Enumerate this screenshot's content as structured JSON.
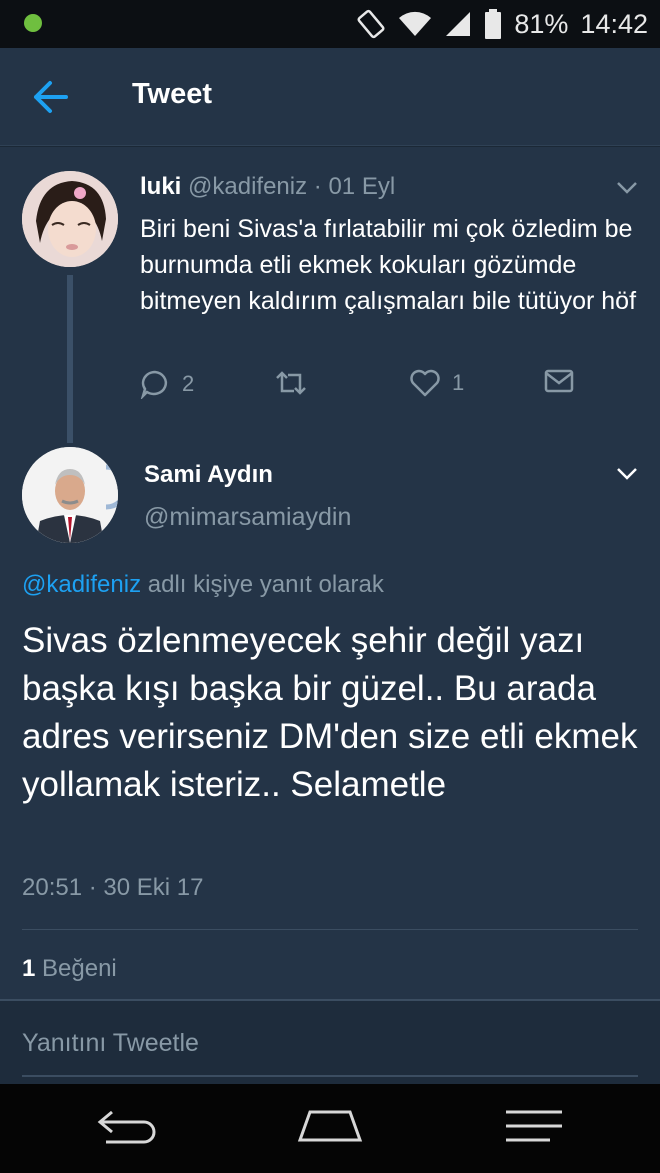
{
  "status_bar": {
    "battery": "81%",
    "time": "14:42",
    "icons": [
      "notification-dot-icon",
      "rotate-icon",
      "wifi-icon",
      "signal-icon",
      "battery-icon"
    ]
  },
  "app_bar": {
    "title": "Tweet",
    "back_icon": "back-arrow-icon"
  },
  "parent_tweet": {
    "name": "luki",
    "handle": "@kadifeniz",
    "separator": "·",
    "date": "01 Eyl",
    "text": "Biri beni Sivas'a fırlatabilir mi çok özledim be burnumda etli ekmek kokuları gözümde bitmeyen kaldırım çalışmaları bile tütüyor höf",
    "reply_count": "2",
    "like_count": "1"
  },
  "main_tweet": {
    "name": "Sami Aydın",
    "handle": "@mimarsamiaydin",
    "reply_mention": "@kadifeniz",
    "reply_suffix": " adlı kişiye yanıt olarak",
    "text": "Sivas özlenmeyecek şehir değil yazı başka kışı başka bir güzel.. Bu arada adres verirseniz DM'den size etli ekmek yollamak isteriz.. Selametle",
    "timestamp": "20:51 · 30 Eki 17",
    "like_count": "1",
    "like_label": " Beğeni"
  },
  "reply_bar": {
    "placeholder": "Yanıtını Tweetle"
  },
  "colors": {
    "background": "#243447",
    "accent": "#1da1f2",
    "secondary_text": "#8899a6"
  }
}
